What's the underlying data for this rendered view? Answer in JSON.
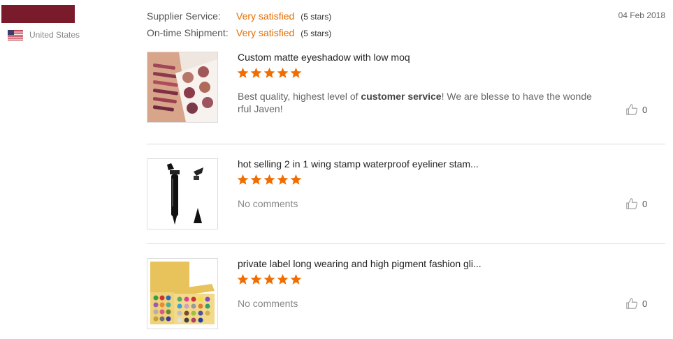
{
  "buyer": {
    "country": "United States",
    "flag_icon": "us-flag-icon"
  },
  "ratings": [
    {
      "label": "Supplier Service:",
      "value": "Very satisfied",
      "stars_text": "(5 stars)"
    },
    {
      "label": "On-time Shipment:",
      "value": "Very satisfied",
      "stars_text": "(5 stars)"
    }
  ],
  "review_date": "04 Feb 2018",
  "reviews": [
    {
      "title": "Custom matte eyeshadow with low moq",
      "stars": 5,
      "text_before": "Best quality, highest level of ",
      "text_bold": "customer service",
      "text_after": "! We are blesse to have the wonde rful Javen!",
      "likes": "0"
    },
    {
      "title": "hot selling 2 in 1 wing stamp waterproof eyeliner stam...",
      "stars": 5,
      "comment": "No comments",
      "likes": "0"
    },
    {
      "title": "private label long wearing and high pigment fashion gli...",
      "stars": 5,
      "comment": "No comments",
      "likes": "0"
    }
  ],
  "colors": {
    "accent_orange": "#e66c00",
    "star_orange": "#f06d00",
    "divider": "#dddddd"
  }
}
